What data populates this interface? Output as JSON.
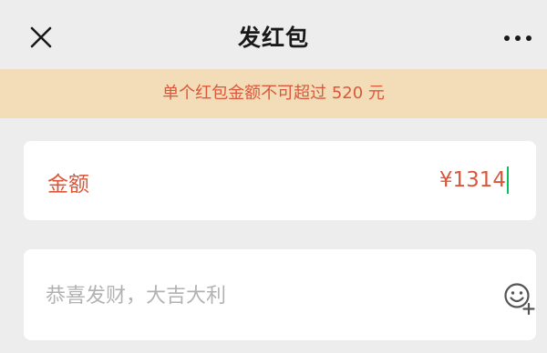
{
  "header": {
    "title": "发红包",
    "close_icon": "close-icon",
    "more_icon": "more-icon"
  },
  "banner": {
    "text": "单个红包金额不可超过 520 元"
  },
  "amount": {
    "label": "金额",
    "value": "¥1314"
  },
  "greeting": {
    "placeholder": "恭喜发财，大吉大利",
    "emoji_icon": "emoji-add-icon"
  },
  "colors": {
    "background": "#EDEDED",
    "banner_bg": "#F2DDB8",
    "warning_text": "#D9583B",
    "caret": "#07C160"
  }
}
